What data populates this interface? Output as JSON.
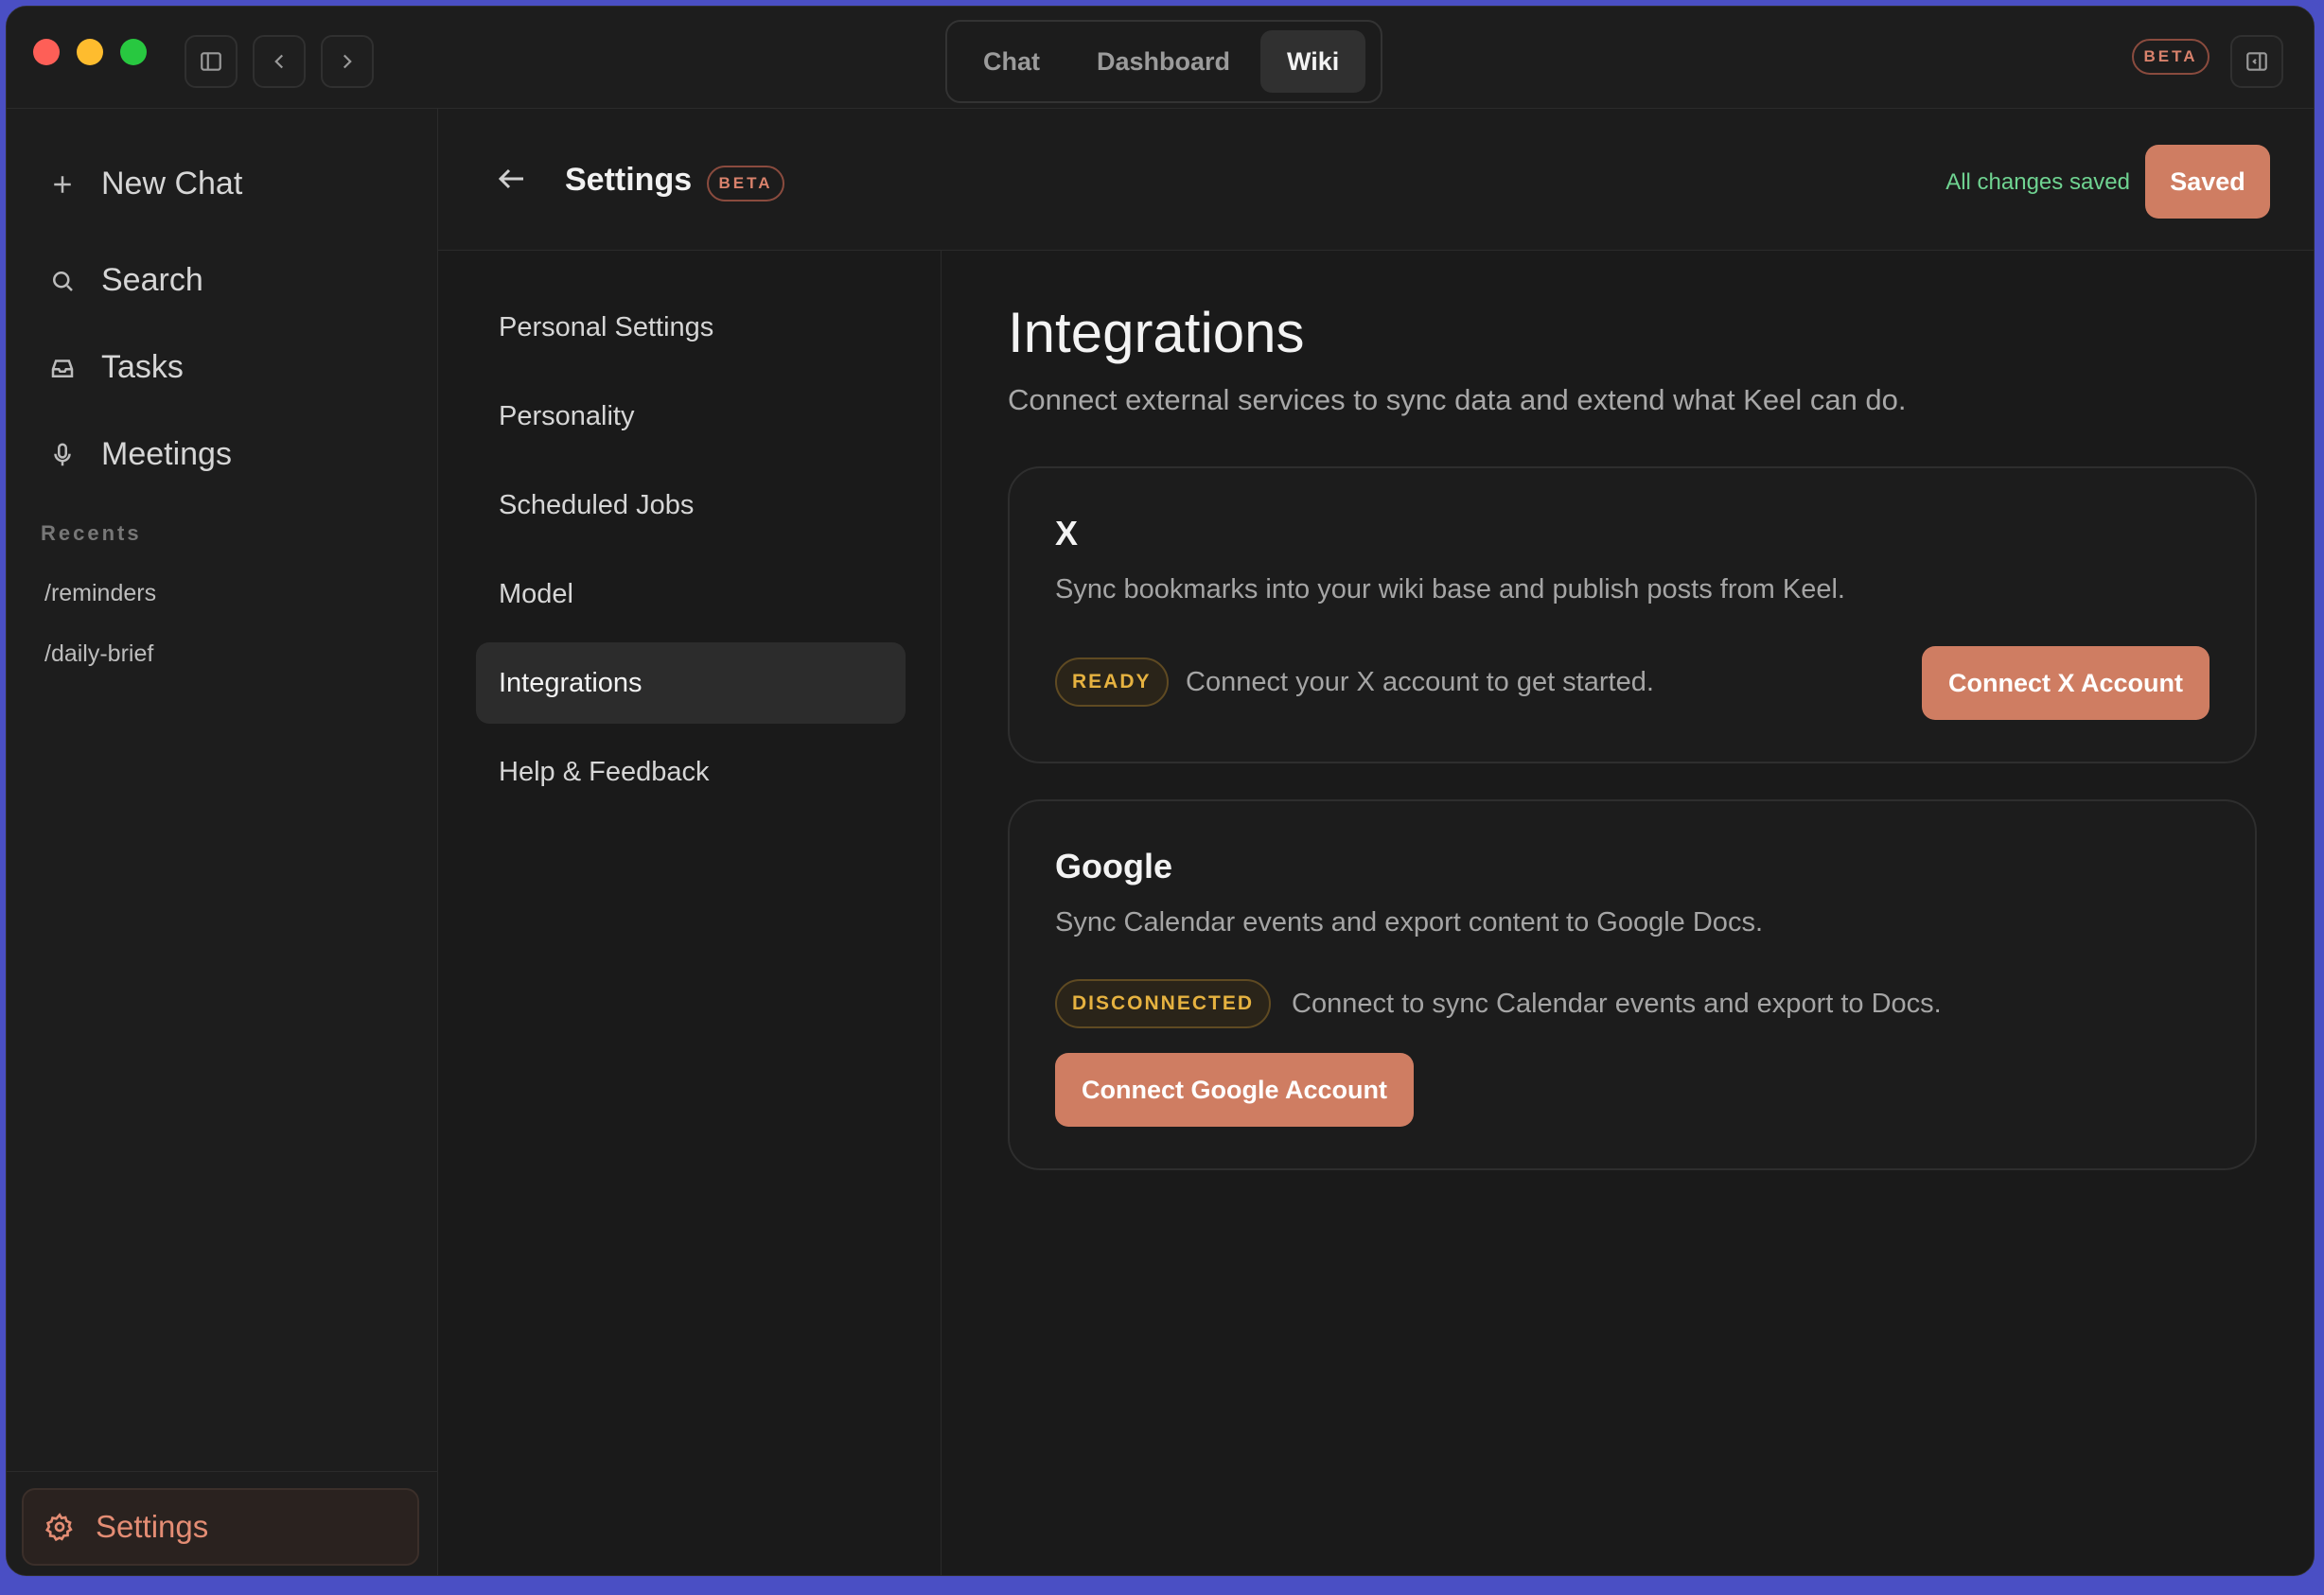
{
  "titlebar": {
    "tabs": [
      {
        "label": "Chat",
        "active": false
      },
      {
        "label": "Dashboard",
        "active": false
      },
      {
        "label": "Wiki",
        "active": true
      }
    ],
    "beta_label": "BETA"
  },
  "sidebar": {
    "items": [
      {
        "label": "New Chat",
        "icon": "plus-icon"
      },
      {
        "label": "Search",
        "icon": "search-icon"
      },
      {
        "label": "Tasks",
        "icon": "inbox-icon"
      },
      {
        "label": "Meetings",
        "icon": "microphone-icon"
      }
    ],
    "recents_label": "Recents",
    "recents": [
      "/reminders",
      "/daily-brief"
    ],
    "settings_label": "Settings"
  },
  "header": {
    "title": "Settings",
    "beta_label": "BETA",
    "status_text": "All changes saved",
    "saved_button": "Saved"
  },
  "settings_nav": {
    "items": [
      {
        "label": "Personal Settings",
        "active": false
      },
      {
        "label": "Personality",
        "active": false
      },
      {
        "label": "Scheduled Jobs",
        "active": false
      },
      {
        "label": "Model",
        "active": false
      },
      {
        "label": "Integrations",
        "active": true
      },
      {
        "label": "Help & Feedback",
        "active": false
      }
    ]
  },
  "integrations": {
    "title": "Integrations",
    "subtitle": "Connect external services to sync data and extend what Keel can do.",
    "cards": [
      {
        "name": "X",
        "description": "Sync bookmarks into your wiki base and publish posts from Keel.",
        "status": "READY",
        "status_text": "Connect your X account to get started.",
        "button": "Connect X Account"
      },
      {
        "name": "Google",
        "description": "Sync Calendar events and export content to Google Docs.",
        "status": "DISCONNECTED",
        "status_text": "Connect to sync Calendar events and export to Docs.",
        "button": "Connect Google Account"
      }
    ]
  },
  "colors": {
    "accent": "#cf7d62",
    "saved_green": "#6fd391",
    "badge_amber": "#e6b240",
    "background": "#1a1a1a"
  }
}
